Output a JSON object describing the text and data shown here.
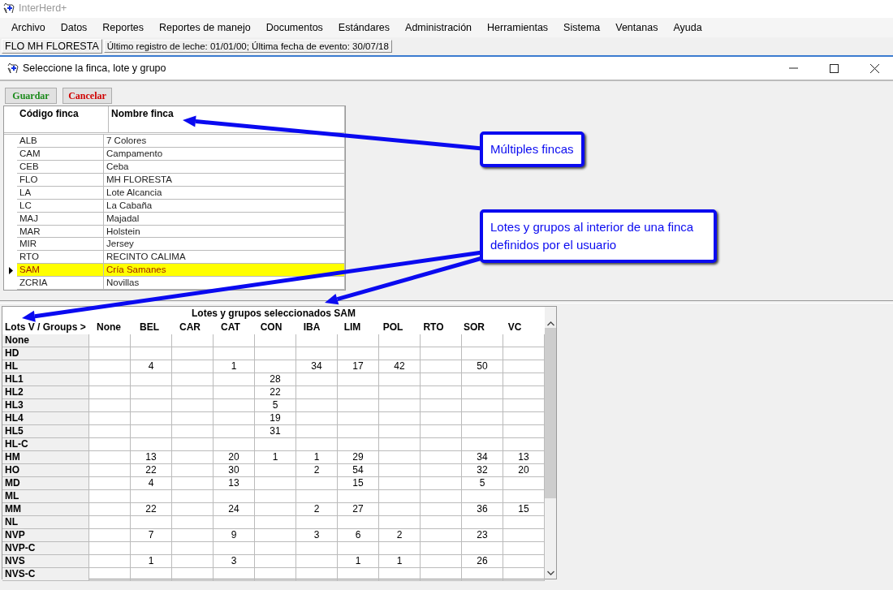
{
  "app": {
    "title": "InterHerd+"
  },
  "menu": [
    "Archivo",
    "Datos",
    "Reportes",
    "Reportes de manejo",
    "Documentos",
    "Estándares",
    "Administración",
    "Herramientas",
    "Sistema",
    "Ventanas",
    "Ayuda"
  ],
  "status_bar": [
    "FLO MH FLORESTA",
    "Último registro de leche: 01/01/00; Última fecha de evento: 30/07/18"
  ],
  "dialog": {
    "title": "Seleccione la finca, lote y grupo",
    "buttons": [
      {
        "label": "Guardar",
        "kind": "save"
      },
      {
        "label": "Cancelar",
        "kind": "cancel"
      }
    ],
    "farms": {
      "columns": [
        "Código finca",
        "Nombre finca"
      ],
      "rows": [
        {
          "code": "ALB",
          "name": "7 Colores",
          "selected": false
        },
        {
          "code": "CAM",
          "name": "Campamento",
          "selected": false
        },
        {
          "code": "CEB",
          "name": "Ceba",
          "selected": false
        },
        {
          "code": "FLO",
          "name": "MH FLORESTA",
          "selected": false
        },
        {
          "code": "LA",
          "name": "Lote Alcancia",
          "selected": false
        },
        {
          "code": "LC",
          "name": "La Cabaña",
          "selected": false
        },
        {
          "code": "MAJ",
          "name": "Majadal",
          "selected": false
        },
        {
          "code": "MAR",
          "name": "Holstein",
          "selected": false
        },
        {
          "code": "MIR",
          "name": "Jersey",
          "selected": false
        },
        {
          "code": "RTO",
          "name": "RECINTO CALIMA",
          "selected": false
        },
        {
          "code": "SAM",
          "name": "Cría Samanes",
          "selected": true
        },
        {
          "code": "ZCRIA",
          "name": "Novillas",
          "selected": false
        }
      ]
    },
    "lots_grid": {
      "title": "Lotes y grupos seleccionados SAM",
      "corner": "Lots V / Groups >",
      "columns": [
        "None",
        "BEL",
        "CAR",
        "CAT",
        "CON",
        "IBA",
        "LIM",
        "POL",
        "RTO",
        "SOR",
        "VC"
      ],
      "rows": [
        {
          "lot": "None",
          "cells": [
            null,
            null,
            null,
            null,
            null,
            null,
            null,
            null,
            null,
            null,
            null
          ]
        },
        {
          "lot": "HD",
          "cells": [
            null,
            null,
            null,
            null,
            null,
            null,
            null,
            null,
            null,
            null,
            null
          ]
        },
        {
          "lot": "HL",
          "cells": [
            null,
            "4",
            null,
            "1",
            null,
            "34",
            "17",
            "42",
            null,
            "50",
            null
          ]
        },
        {
          "lot": "HL1",
          "cells": [
            null,
            null,
            null,
            null,
            "28",
            null,
            null,
            null,
            null,
            null,
            null
          ]
        },
        {
          "lot": "HL2",
          "cells": [
            null,
            null,
            null,
            null,
            "22",
            null,
            null,
            null,
            null,
            null,
            null
          ]
        },
        {
          "lot": "HL3",
          "cells": [
            null,
            null,
            null,
            null,
            "5",
            null,
            null,
            null,
            null,
            null,
            null
          ]
        },
        {
          "lot": "HL4",
          "cells": [
            null,
            null,
            null,
            null,
            "19",
            null,
            null,
            null,
            null,
            null,
            null
          ]
        },
        {
          "lot": "HL5",
          "cells": [
            null,
            null,
            null,
            null,
            "31",
            null,
            null,
            null,
            null,
            null,
            null
          ]
        },
        {
          "lot": "HL-C",
          "cells": [
            null,
            null,
            null,
            null,
            null,
            null,
            null,
            null,
            null,
            null,
            null
          ]
        },
        {
          "lot": "HM",
          "cells": [
            null,
            "13",
            null,
            "20",
            "1",
            "1",
            "29",
            null,
            null,
            "34",
            "13"
          ]
        },
        {
          "lot": "HO",
          "cells": [
            null,
            "22",
            null,
            "30",
            null,
            "2",
            "54",
            null,
            null,
            "32",
            "20"
          ]
        },
        {
          "lot": "MD",
          "cells": [
            null,
            "4",
            null,
            "13",
            null,
            null,
            "15",
            null,
            null,
            "5",
            null
          ]
        },
        {
          "lot": "ML",
          "cells": [
            null,
            null,
            null,
            null,
            null,
            null,
            null,
            null,
            null,
            null,
            null
          ]
        },
        {
          "lot": "MM",
          "cells": [
            null,
            "22",
            null,
            "24",
            null,
            "2",
            "27",
            null,
            null,
            "36",
            "15"
          ]
        },
        {
          "lot": "NL",
          "cells": [
            null,
            null,
            null,
            null,
            null,
            null,
            null,
            null,
            null,
            null,
            null
          ]
        },
        {
          "lot": "NVP",
          "cells": [
            null,
            "7",
            null,
            "9",
            null,
            "3",
            "6",
            "2",
            null,
            "23",
            null
          ]
        },
        {
          "lot": "NVP-C",
          "cells": [
            null,
            null,
            null,
            null,
            null,
            null,
            null,
            null,
            null,
            null,
            null
          ]
        },
        {
          "lot": "NVS",
          "cells": [
            null,
            "1",
            null,
            "3",
            null,
            null,
            "1",
            "1",
            null,
            "26",
            null
          ]
        },
        {
          "lot": "NVS-C",
          "cells": [
            null,
            null,
            null,
            null,
            null,
            null,
            null,
            null,
            null,
            null,
            null
          ]
        }
      ]
    }
  },
  "annotations": [
    {
      "text": "Múltiples fincas"
    },
    {
      "text": "Lotes y grupos al interior de una finca definidos por el usuario"
    }
  ]
}
